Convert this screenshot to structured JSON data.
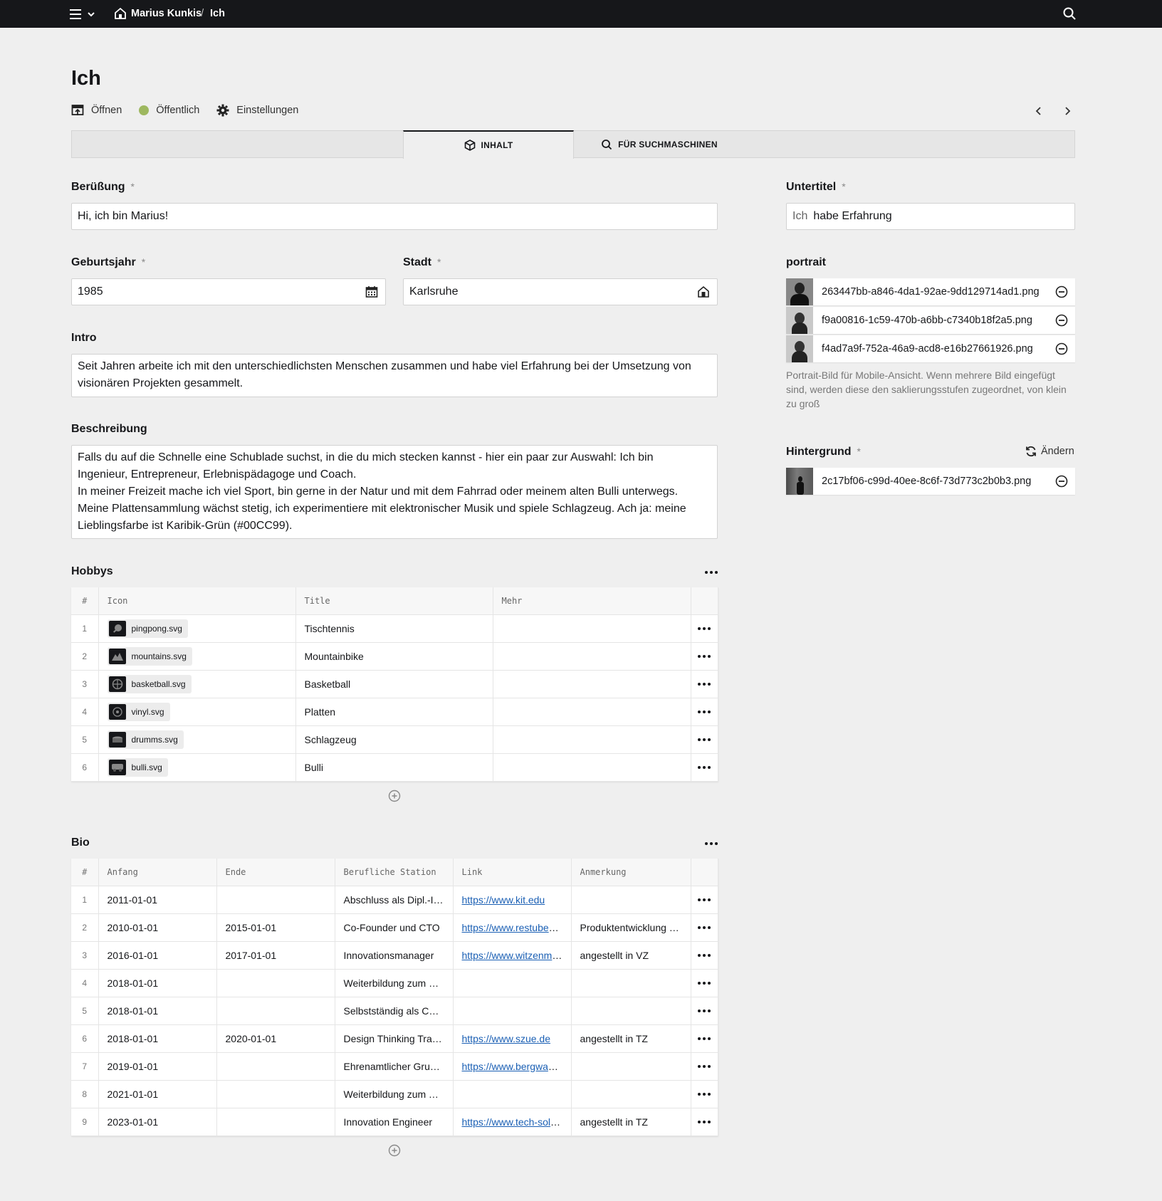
{
  "topbar": {
    "site_name": "Marius Kunkis",
    "separator": "/",
    "page_name": "Ich"
  },
  "page": {
    "title": "Ich",
    "actions": {
      "open": "Öffnen",
      "public": "Öffentlich",
      "settings": "Einstellungen"
    },
    "status_color": "#9eb860"
  },
  "tabs": {
    "content": "INHALT",
    "seo": "FÜR SUCHMASCHINEN"
  },
  "fields": {
    "greeting": {
      "label": "Berüßung",
      "required": "*",
      "value": "Hi, ich bin Marius!"
    },
    "birthyear": {
      "label": "Geburtsjahr",
      "required": "*",
      "value": "1985"
    },
    "city": {
      "label": "Stadt",
      "required": "*",
      "value": "Karlsruhe"
    },
    "intro": {
      "label": "Intro",
      "value": "Seit Jahren arbeite ich mit den unterschiedlichsten Menschen zusammen und habe viel Erfahrung bei der Umsetzung von\nvisionären Projekten gesammelt."
    },
    "description": {
      "label": "Beschreibung",
      "value": "Falls du auf die Schnelle eine Schublade suchst, in die du mich stecken kannst - hier ein paar zur Auswahl: Ich bin\nIngenieur, Entrepreneur, Erlebnispädagoge und Coach.\nIn meiner Freizeit mache ich viel Sport, bin gerne in der Natur und mit dem Fahrrad oder meinem alten Bulli unterwegs.\nMeine Plattensammlung wächst stetig, ich experimentiere mit elektronischer Musik und spiele Schlagzeug. Ach ja: meine\nLieblingsfarbe ist Karibik-Grün (#00CC99)."
    },
    "subtitle": {
      "label": "Untertitel",
      "required": "*",
      "prefix": "Ich",
      "value": "habe Erfahrung"
    },
    "portrait": {
      "label": "portrait",
      "files": [
        "263447bb-a846-4da1-92ae-9dd129714ad1.png",
        "f9a00816-1c59-470b-a6bb-c7340b18f2a5.png",
        "f4ad7a9f-752a-46a9-acd8-e16b27661926.png"
      ],
      "help": "Portrait-Bild für Mobile-Ansicht. Wenn mehrere Bild eingefügt sind, werden diese den saklierungsstufen zugeordnet, von klein zu groß"
    },
    "background": {
      "label": "Hintergrund",
      "required": "*",
      "change": "Ändern",
      "file": "2c17bf06-c99d-40ee-8c6f-73d773c2b0b3.png"
    }
  },
  "hobbys": {
    "title": "Hobbys",
    "columns": [
      "#",
      "Icon",
      "Title",
      "Mehr"
    ],
    "rows": [
      {
        "n": "1",
        "icon": "pingpong.svg",
        "title": "Tischtennis",
        "mehr": ""
      },
      {
        "n": "2",
        "icon": "mountains.svg",
        "title": "Mountainbike",
        "mehr": ""
      },
      {
        "n": "3",
        "icon": "basketball.svg",
        "title": "Basketball",
        "mehr": ""
      },
      {
        "n": "4",
        "icon": "vinyl.svg",
        "title": "Platten",
        "mehr": ""
      },
      {
        "n": "5",
        "icon": "drumms.svg",
        "title": "Schlagzeug",
        "mehr": ""
      },
      {
        "n": "6",
        "icon": "bulli.svg",
        "title": "Bulli",
        "mehr": ""
      }
    ]
  },
  "bio": {
    "title": "Bio",
    "columns": [
      "#",
      "Anfang",
      "Ende",
      "Berufliche Station",
      "Link",
      "Anmerkung"
    ],
    "rows": [
      {
        "n": "1",
        "start": "2011-01-01",
        "end": "",
        "station": "Abschluss als Dipl.-Ing.",
        "link": "https://www.kit.edu",
        "note": ""
      },
      {
        "n": "2",
        "start": "2010-01-01",
        "end": "2015-01-01",
        "station": "Co-Founder und CTO",
        "link": "https://www.restubes.com",
        "note": "Produktentwicklung und Vertrieb"
      },
      {
        "n": "3",
        "start": "2016-01-01",
        "end": "2017-01-01",
        "station": "Innovationsmanager",
        "link": "https://www.witzenmann.de",
        "note": "angestellt in VZ"
      },
      {
        "n": "4",
        "start": "2018-01-01",
        "end": "",
        "station": "Weiterbildung zum Coach",
        "link": "",
        "note": ""
      },
      {
        "n": "5",
        "start": "2018-01-01",
        "end": "",
        "station": "Selbstständig als Coach",
        "link": "",
        "note": ""
      },
      {
        "n": "6",
        "start": "2018-01-01",
        "end": "2020-01-01",
        "station": "Design Thinking Trainer",
        "link": "https://www.szue.de",
        "note": "angestellt in TZ"
      },
      {
        "n": "7",
        "start": "2019-01-01",
        "end": "",
        "station": "Ehrenamtlicher Gruppenleiter",
        "link": "https://www.bergwacht.de",
        "note": ""
      },
      {
        "n": "8",
        "start": "2021-01-01",
        "end": "",
        "station": "Weiterbildung zum Trainer",
        "link": "",
        "note": ""
      },
      {
        "n": "9",
        "start": "2023-01-01",
        "end": "",
        "station": "Innovation Engineer",
        "link": "https://www.tech-solute.de",
        "note": "angestellt in TZ"
      }
    ]
  }
}
